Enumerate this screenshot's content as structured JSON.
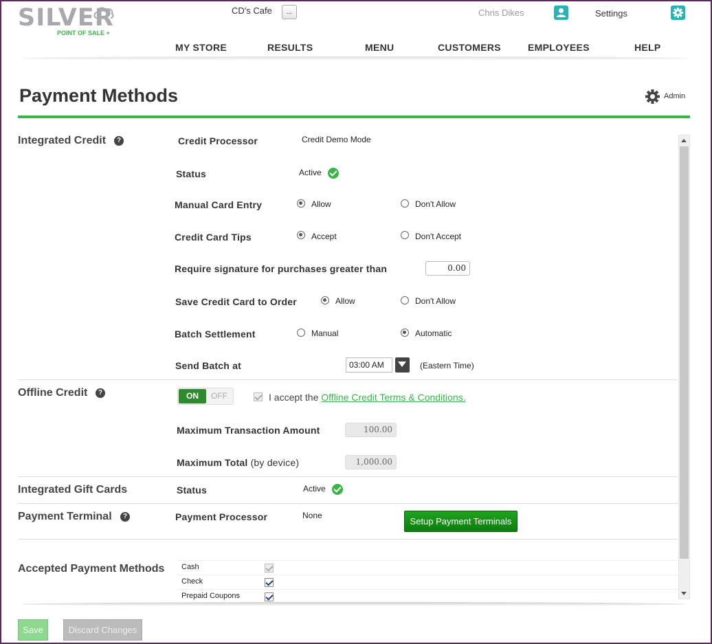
{
  "header": {
    "logo_word": "SILVER",
    "logo_tagline": "POINT OF SALE +",
    "store_name": "CD's Cafe",
    "store_button": "...",
    "user_name": "Chris Dikes",
    "settings_label": "Settings",
    "accent_color": "#2bb3b3"
  },
  "nav": {
    "items": [
      "MY STORE",
      "RESULTS",
      "MENU",
      "CUSTOMERS",
      "EMPLOYEES",
      "HELP"
    ]
  },
  "page": {
    "title": "Payment Methods",
    "admin_label": "Admin",
    "rule_color": "#39b54a"
  },
  "integrated_credit": {
    "title": "Integrated Credit",
    "help": "?",
    "processor_label": "Credit Processor",
    "processor_value": "Credit Demo Mode",
    "status_label": "Status",
    "status_value": "Active",
    "manual_entry_label": "Manual Card Entry",
    "manual_entry_options": [
      "Allow",
      "Don't Allow"
    ],
    "manual_entry_selected": "Allow",
    "tips_label": "Credit Card Tips",
    "tips_options": [
      "Accept",
      "Don't Accept"
    ],
    "tips_selected": "Accept",
    "signature_label": "Require signature for purchases greater than",
    "signature_value": "0.00",
    "save_card_label": "Save Credit Card to Order",
    "save_card_options": [
      "Allow",
      "Don't Allow"
    ],
    "save_card_selected": "Allow",
    "batch_label": "Batch Settlement",
    "batch_options": [
      "Manual",
      "Automatic"
    ],
    "batch_selected": "Automatic",
    "send_batch_label": "Send Batch at",
    "send_batch_time": "03:00 AM",
    "timezone": "(Eastern Time)"
  },
  "offline_credit": {
    "title": "Offline Credit",
    "help": "?",
    "toggle_on": "ON",
    "toggle_off": "OFF",
    "terms_prefix": "I accept the",
    "terms_link": "Offline Credit Terms & Conditions.",
    "max_txn_label": "Maximum Transaction Amount",
    "max_txn_value": "100.00",
    "max_total_label": "Maximum Total",
    "max_total_suffix": "(by device)",
    "max_total_value": "1,000.00"
  },
  "gift_cards": {
    "title": "Integrated Gift Cards",
    "status_label": "Status",
    "status_value": "Active"
  },
  "payment_terminal": {
    "title": "Payment Terminal",
    "help": "?",
    "processor_label": "Payment Processor",
    "processor_value": "None",
    "setup_button": "Setup Payment Terminals"
  },
  "accepted_methods": {
    "title": "Accepted Payment Methods",
    "items": [
      {
        "label": "Cash",
        "checked": true,
        "disabled": true
      },
      {
        "label": "Check",
        "checked": true,
        "disabled": false
      },
      {
        "label": "Prepaid Coupons",
        "checked": true,
        "disabled": false
      }
    ]
  },
  "footer": {
    "save_label": "Save",
    "discard_label": "Discard Changes"
  }
}
